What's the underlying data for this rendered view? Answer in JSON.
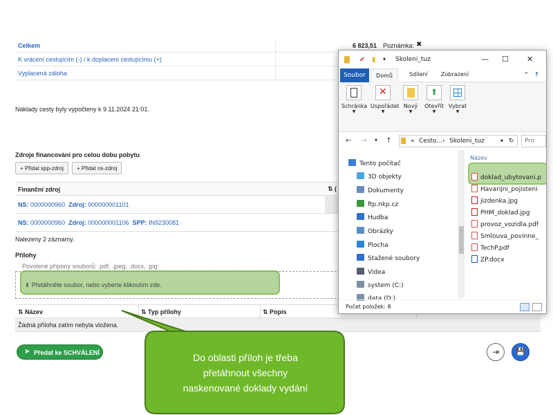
{
  "summary": {
    "celkem_label": "Celkem",
    "celkem_amount": "6 823,51",
    "note_label": "Poznámka:",
    "note_x": "✖",
    "vraceni_label": "K vrácení cestujícím (-) / k doplacení cestujícímu (+)",
    "zaloha_label": "Vyplacená záloha"
  },
  "calc_note": "Náklady cesty byly vypočteny k 9.11.2024 21:01.",
  "financing": {
    "title": "Zdroje financování pro celou dobu pobytu",
    "add_spp": "+ Přidat spp-zdroj",
    "add_ns": "+ Přidat ns-zdroj",
    "col_source": "Finanční zdroj",
    "col_sort_icon": "⇅ (",
    "rows": [
      {
        "ns_label": "NS:",
        "ns": "0000000960",
        "zdroj_label": "Zdroj:",
        "zdroj": "000000001101",
        "spp_label": "",
        "spp": ""
      },
      {
        "ns_label": "NS:",
        "ns": "0000000960",
        "zdroj_label": "Zdroj:",
        "zdroj": "000000001106",
        "spp_label": "SPP:",
        "spp": "IN9230081"
      }
    ],
    "found": "Nalezeny 2 záznamy."
  },
  "attachments": {
    "title": "Přílohy",
    "allowed": "Povolené přípony souborů: .pdf, .jpeg, .docx, .jpg",
    "drop_text": "Přetáhněte soubor, nebo vyberte kliknutím zde.",
    "drop_icon": "⬆",
    "col_name": "⇅ Název",
    "col_type": "⇅ Typ přílohy",
    "col_desc": "⇅ Popis",
    "empty": "Žádná příloha zatím nebyla vložena."
  },
  "buttons": {
    "approve": "Předat ke SCHVÁLENÍ",
    "approve_icon": "➤",
    "exit_icon": "⇥",
    "save_icon": "💾"
  },
  "explorer": {
    "title": "Skoleni_tuz",
    "minimize": "—",
    "maximize": "☐",
    "close": "✕",
    "help": "?",
    "expand": "^",
    "tabs": [
      "Soubor",
      "Domů",
      "Sdílení",
      "Zobrazení"
    ],
    "ribbon": [
      {
        "label": "Schránka",
        "icon": "clipboard-icon"
      },
      {
        "label": "Uspořádat",
        "icon": "organize-icon"
      },
      {
        "label": "Nový",
        "icon": "new-folder-icon"
      },
      {
        "label": "Otevřít",
        "icon": "open-icon"
      },
      {
        "label": "Vybrat",
        "icon": "select-icon"
      }
    ],
    "path_parts": [
      "«",
      "Cesto...",
      "›",
      "Skoleni_tuz"
    ],
    "search_placeholder": "Pro",
    "nav": [
      {
        "label": "Tento počítač",
        "color": "#3c7fd4"
      },
      {
        "label": "3D objekty",
        "color": "#4aa7d8"
      },
      {
        "label": "Dokumenty",
        "color": "#6d8cb8"
      },
      {
        "label": "ftp.nkp.cz",
        "color": "#3a9a3a"
      },
      {
        "label": "Hudba",
        "color": "#2f6fce"
      },
      {
        "label": "Obrázky",
        "color": "#5a8fc8"
      },
      {
        "label": "Plocha",
        "color": "#2c86d8"
      },
      {
        "label": "Stažené soubory",
        "color": "#2f6fce"
      },
      {
        "label": "Videa",
        "color": "#555f70"
      },
      {
        "label": "system (C:)",
        "color": "#7f8fa8"
      },
      {
        "label": "data (D:)",
        "color": "#7f8fa8"
      }
    ],
    "files_col": "Název",
    "files": [
      "doklad_ubytovani.p",
      "Havarijni_pojisteni",
      "jizdenka.jpg",
      "PHM_doklad.jpg",
      "provoz_vozidla.pdf",
      "Smlouva_povinne_",
      "TechP.pdf",
      "ZP.docx"
    ],
    "status": "Počet položek: 8"
  },
  "callout": {
    "text_line1": "Do oblasti příloh je třeba",
    "text_line2": "přetáhnout všechny",
    "text_line3": "naskenované doklady vydání",
    "fill": "#6fb82a",
    "border": "#4a7a1c"
  }
}
